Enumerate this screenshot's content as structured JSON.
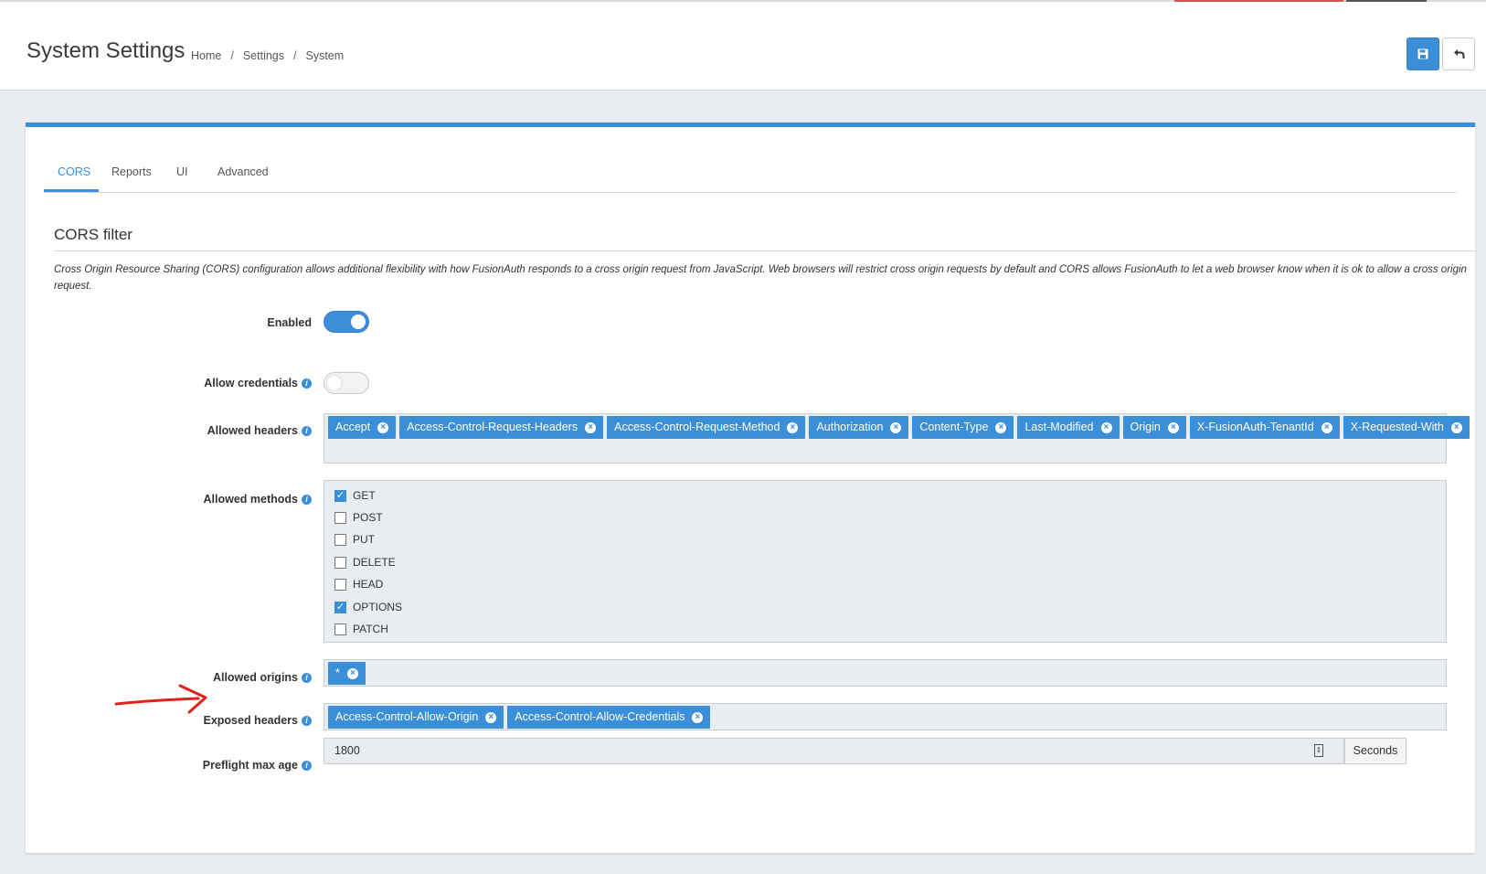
{
  "header": {
    "title": "System Settings",
    "breadcrumb": [
      "Home",
      "Settings",
      "System"
    ],
    "breadcrumb_sep": "/"
  },
  "tabs": [
    {
      "label": "CORS",
      "active": true
    },
    {
      "label": "Reports",
      "active": false
    },
    {
      "label": "UI",
      "active": false
    },
    {
      "label": "Advanced",
      "active": false
    }
  ],
  "section": {
    "title": "CORS filter",
    "description": "Cross Origin Resource Sharing (CORS) configuration allows additional flexibility with how FusionAuth responds to a cross origin request from JavaScript. Web browsers will restrict cross origin requests by default and CORS allows FusionAuth to let a web browser know when it is ok to allow a cross origin request."
  },
  "fields": {
    "enabled": {
      "label": "Enabled",
      "value": true
    },
    "allow_credentials": {
      "label": "Allow credentials",
      "value": false
    },
    "allowed_headers": {
      "label": "Allowed headers",
      "values": [
        "Accept",
        "Access-Control-Request-Headers",
        "Access-Control-Request-Method",
        "Authorization",
        "Content-Type",
        "Last-Modified",
        "Origin",
        "X-FusionAuth-TenantId",
        "X-Requested-With"
      ]
    },
    "allowed_methods": {
      "label": "Allowed methods",
      "options": [
        {
          "label": "GET",
          "checked": true
        },
        {
          "label": "POST",
          "checked": false
        },
        {
          "label": "PUT",
          "checked": false
        },
        {
          "label": "DELETE",
          "checked": false
        },
        {
          "label": "HEAD",
          "checked": false
        },
        {
          "label": "OPTIONS",
          "checked": true
        },
        {
          "label": "PATCH",
          "checked": false
        }
      ]
    },
    "allowed_origins": {
      "label": "Allowed origins",
      "values": [
        "*"
      ]
    },
    "exposed_headers": {
      "label": "Exposed headers",
      "values": [
        "Access-Control-Allow-Origin",
        "Access-Control-Allow-Credentials"
      ]
    },
    "preflight_max_age": {
      "label": "Preflight max age",
      "value": "1800",
      "unit": "Seconds"
    }
  },
  "colors": {
    "accent": "#3b8fd9",
    "annotation_arrow": "#e0231a"
  }
}
